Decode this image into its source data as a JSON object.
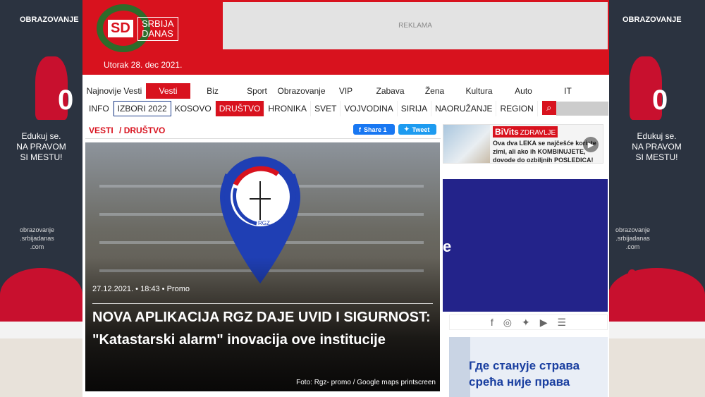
{
  "skin": {
    "brand": "OBRAZOVANJE",
    "big_letter": "0",
    "tagline": [
      "Edukuj se.",
      "NA PRAVOM",
      "SI MESTU!"
    ],
    "site": [
      "obrazovanje",
      ".srbijadanas",
      ".com"
    ]
  },
  "header": {
    "logo_sd": "SD",
    "logo_text_line1": "SRBIJA",
    "logo_text_line2": "DANAS",
    "date": "Utorak 28. dec 2021.",
    "ad_label": "REKLAMA",
    "accent_color": "#d8121e"
  },
  "nav_primary": [
    {
      "label": "Najnovije Vesti",
      "active": false
    },
    {
      "label": "Vesti",
      "active": true
    },
    {
      "label": "Biz",
      "active": false
    },
    {
      "label": "Sport",
      "active": false
    },
    {
      "label": "Obrazovanje",
      "active": false
    },
    {
      "label": "VIP",
      "active": false
    },
    {
      "label": "Zabava",
      "active": false
    },
    {
      "label": "Žena",
      "active": false
    },
    {
      "label": "Kultura",
      "active": false
    },
    {
      "label": "Auto",
      "active": false
    },
    {
      "label": "IT",
      "active": false
    }
  ],
  "nav_secondary": [
    {
      "label": "INFO",
      "style": ""
    },
    {
      "label": "IZBORI 2022",
      "style": "boxed"
    },
    {
      "label": "KOSOVO",
      "style": ""
    },
    {
      "label": "DRUŠTVO",
      "style": "active"
    },
    {
      "label": "HRONIKA",
      "style": ""
    },
    {
      "label": "SVET",
      "style": ""
    },
    {
      "label": "VOJVODINA",
      "style": ""
    },
    {
      "label": "SIRIJA",
      "style": ""
    },
    {
      "label": "NAORUŽANJE",
      "style": ""
    },
    {
      "label": "REGION",
      "style": ""
    }
  ],
  "breadcrumb": {
    "section": "VESTI",
    "sep": "/",
    "subsection": "DRUŠTVO"
  },
  "share": {
    "facebook": "Share 1",
    "twitter": "Tweet"
  },
  "article": {
    "date": "27.12.2021.",
    "time": "18:43",
    "category": "Promo",
    "headline": "NOVA APLIKACIJA RGZ DAJE UVID I SIGURNOST: \"Katastarski alarm\" inovacija ove institucije",
    "photo_credit": "Foto: Rgz- promo / Google maps printscreen",
    "pin_text": "RGZ"
  },
  "sidebar_promo": {
    "brand": "BiVits",
    "brand_sub": "ZDRAVLJE",
    "text": "Ova dva LEKA se najčešće koriste zimi, ali ako ih KOMBINUJETE, dovode do ozbiljnih POSLEDICA!"
  },
  "sidebar_banner_letter": "e",
  "cyrillic_ad": {
    "line1": "Где станује страва",
    "line2": "срећа није права"
  }
}
